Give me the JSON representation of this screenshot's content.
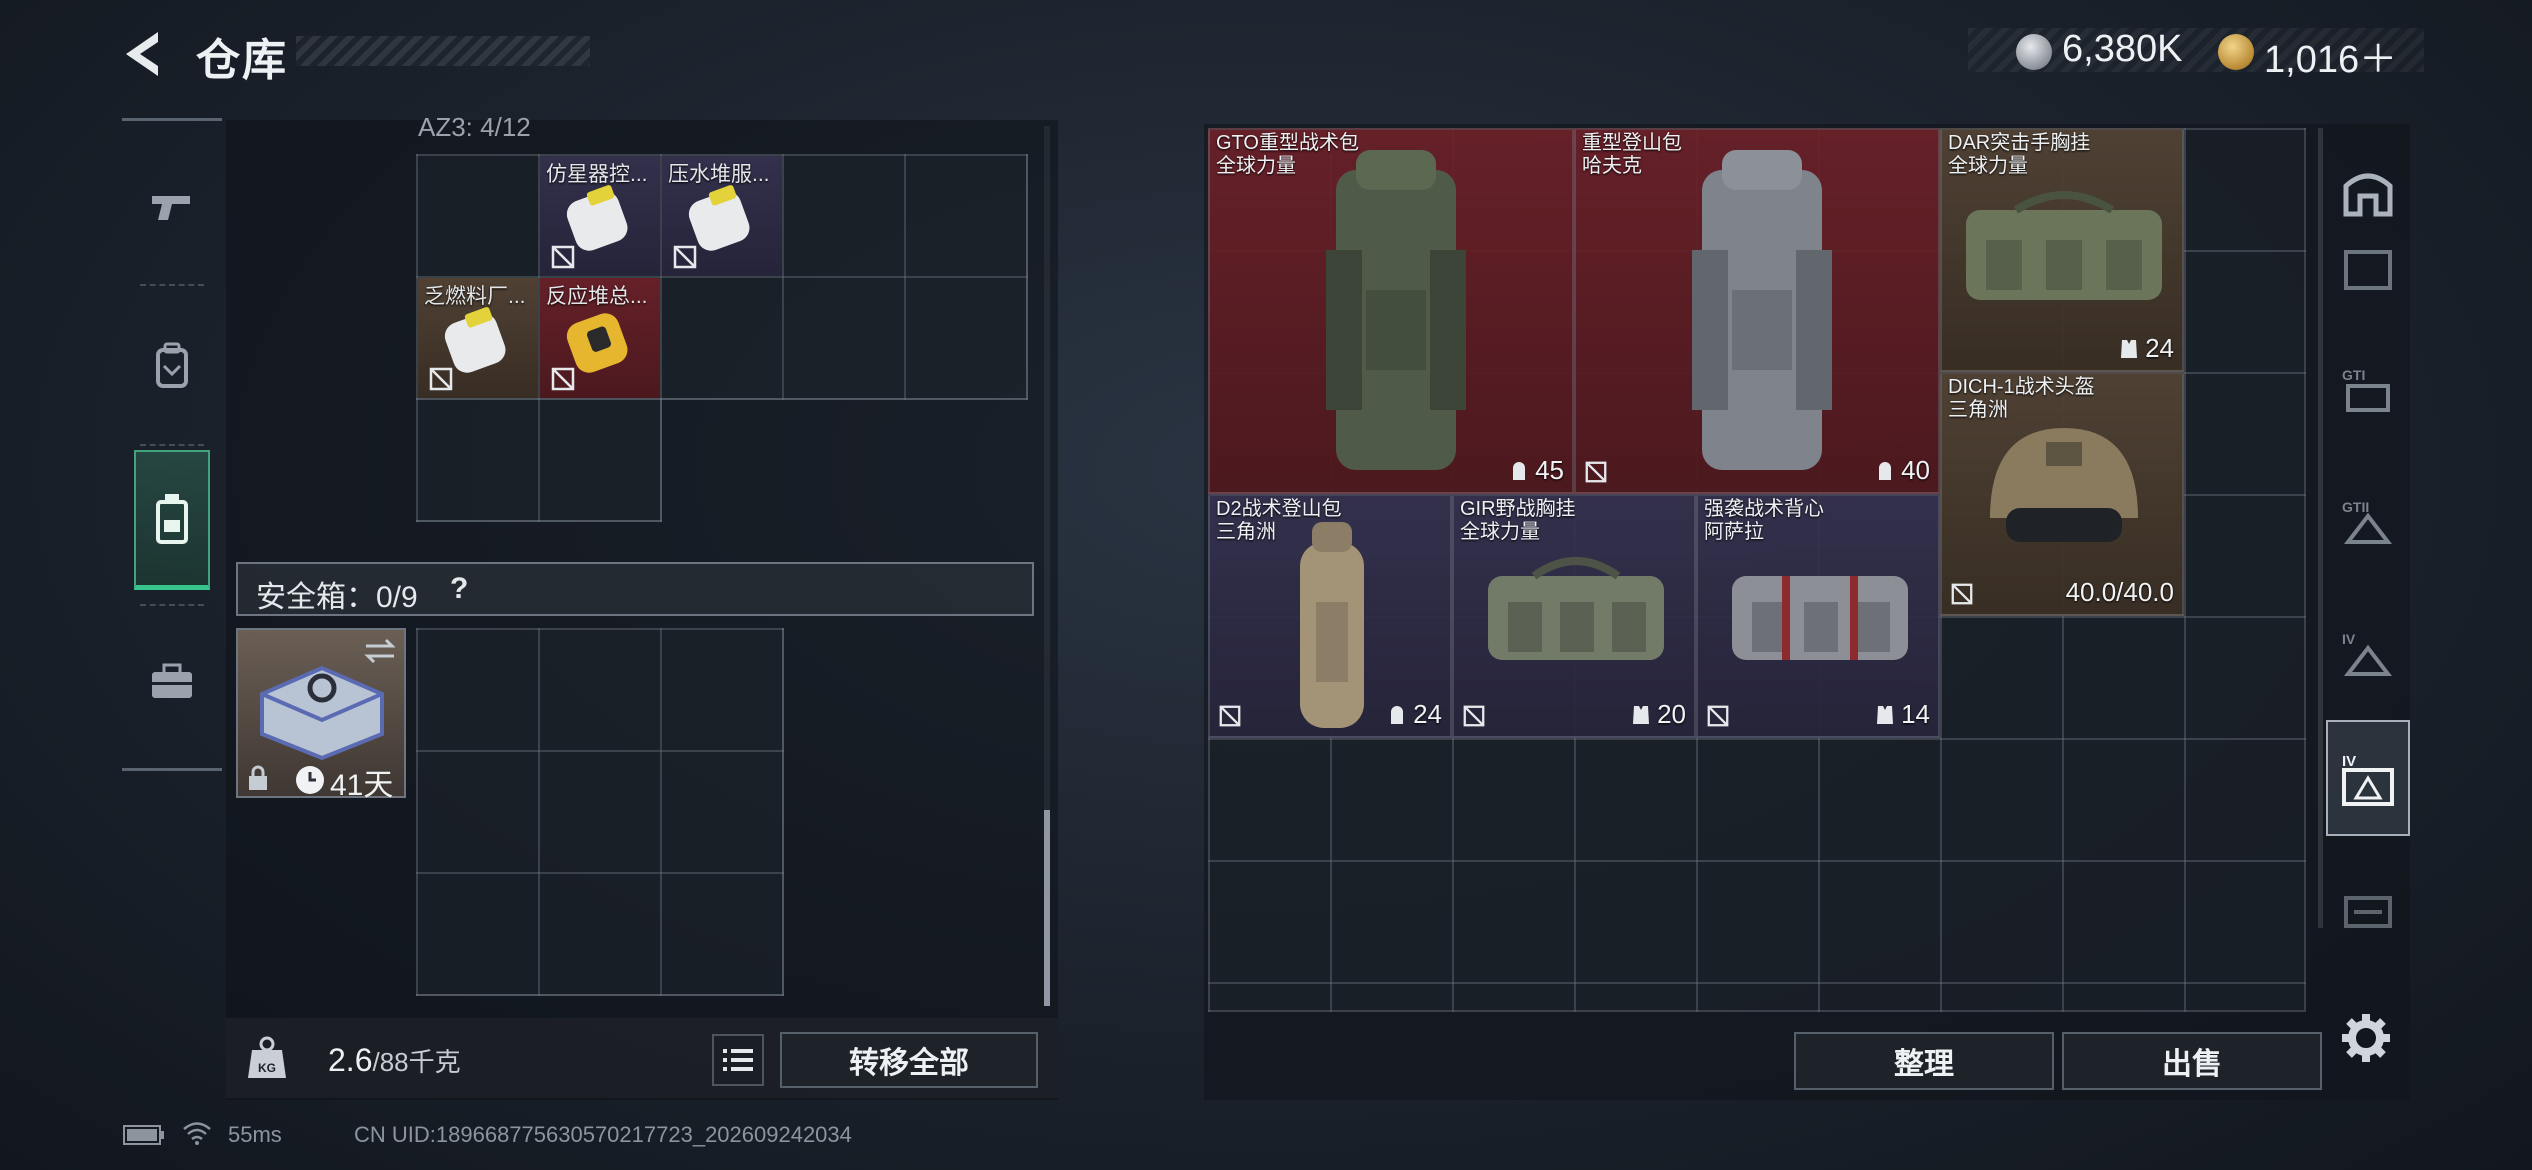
{
  "header": {
    "title": "仓库",
    "currency": [
      {
        "icon": "silver-coin-icon",
        "value": "6,380K"
      },
      {
        "icon": "gold-coin-icon",
        "value": "1,016＋"
      }
    ]
  },
  "left_rail": [
    "pistol-icon",
    "backpack-icon",
    "rig-icon",
    "toolbox-icon"
  ],
  "container": {
    "label": "AZ3: 4/12",
    "items": [
      {
        "name": "仿星器控..."
      },
      {
        "name": "压水堆服..."
      },
      {
        "name": "乏燃料厂..."
      },
      {
        "name": "反应堆总..."
      }
    ]
  },
  "safebox": {
    "label": "安全箱：0/9",
    "help": "?",
    "days": "41天"
  },
  "bottom_left": {
    "weight": "2.6",
    "weight_max": "/88千克",
    "transfer_label": "转移全部"
  },
  "status": {
    "ping": "55ms",
    "uid": "CN UID:18966877563057021772​3_202609242034"
  },
  "stash_items": [
    {
      "name": "GTO重型战术包",
      "faction": "全球力量",
      "value": "45",
      "stat_icon": "capacity-icon"
    },
    {
      "name": "重型登山包",
      "faction": "哈夫克",
      "value": "40",
      "stat_icon": "capacity-icon"
    },
    {
      "name": "DAR突击手胸挂",
      "faction": "全球力量",
      "value": "24",
      "stat_icon": "vest-icon"
    },
    {
      "name": "DICH-1战术头盔",
      "faction": "三角洲",
      "value": "40.0/40.0",
      "stat_icon": "durability"
    },
    {
      "name": "D2战术登山包",
      "faction": "三角洲",
      "value": "24",
      "stat_icon": "capacity-icon"
    },
    {
      "name": "GIR野战胸挂",
      "faction": "全球力量",
      "value": "20",
      "stat_icon": "vest-icon"
    },
    {
      "name": "强袭战术背心",
      "faction": "阿萨拉",
      "value": "14",
      "stat_icon": "vest-icon"
    }
  ],
  "right_rail": [
    "stash-home-icon",
    "stash-tab-1",
    "stash-tab-gti",
    "stash-tab-gtii",
    "stash-tab-iv",
    "stash-tab-iv-active",
    "stash-tab-7"
  ],
  "buttons": {
    "sort_label": "整理",
    "sell_label": "出售"
  },
  "colors": {
    "accent_green": "#37c48d",
    "rarity_red": "#6e2028",
    "rarity_purple": "#363250",
    "rarity_gold": "#524234"
  }
}
